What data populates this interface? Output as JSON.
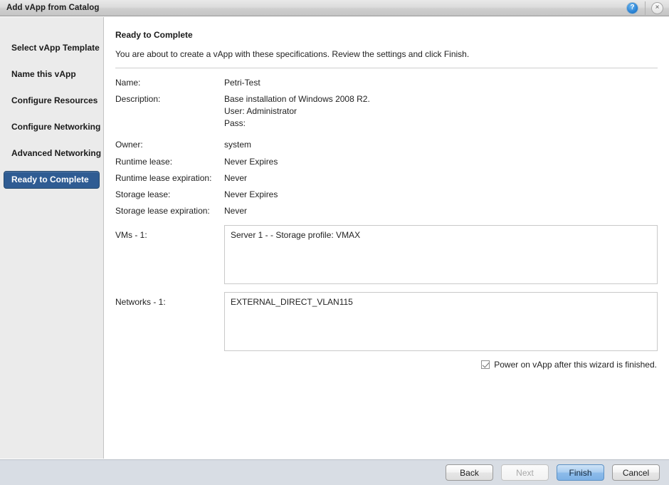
{
  "window": {
    "title": "Add vApp from Catalog",
    "help_icon": "help-circle-icon",
    "help_glyph": "?",
    "close_icon": "close-icon",
    "close_glyph": "×"
  },
  "sidebar": {
    "items": [
      {
        "label": "Select vApp Template",
        "selected": false
      },
      {
        "label": "Name this vApp",
        "selected": false
      },
      {
        "label": "Configure Resources",
        "selected": false
      },
      {
        "label": "Configure Networking",
        "selected": false
      },
      {
        "label": "Advanced Networking",
        "selected": false
      },
      {
        "label": "Ready to Complete",
        "selected": true
      }
    ]
  },
  "main": {
    "title": "Ready to Complete",
    "subtitle": "You are about to create a vApp with these specifications. Review the settings and click Finish.",
    "details": [
      {
        "label": "Name:",
        "value": "Petri-Test"
      },
      {
        "label": "Owner:",
        "value": "system"
      },
      {
        "label": "Runtime lease:",
        "value": "Never Expires"
      },
      {
        "label": "Runtime lease expiration:",
        "value": "Never"
      },
      {
        "label": "Storage lease:",
        "value": "Never Expires"
      },
      {
        "label": "Storage lease expiration:",
        "value": "Never"
      }
    ],
    "description": {
      "label": "Description:",
      "line1": "Base installation of Windows 2008 R2.",
      "line2": "User: Administrator",
      "line3": "Pass:"
    },
    "vms": {
      "label": "VMs - 1:",
      "entries": [
        "Server 1 -  - Storage profile: VMAX"
      ]
    },
    "networks": {
      "label": "Networks - 1:",
      "entries": [
        "EXTERNAL_DIRECT_VLAN115"
      ]
    },
    "power_on": {
      "label": "Power on vApp after this wizard is finished.",
      "checked": true
    }
  },
  "footer": {
    "back_label": "Back",
    "next_label": "Next",
    "finish_label": "Finish",
    "cancel_label": "Cancel"
  },
  "colors": {
    "selected_nav": "#2f5c93",
    "primary_button": "#8dbcea",
    "footer_bar": "#d8dde4",
    "sidebar_bg": "#ebebeb"
  }
}
